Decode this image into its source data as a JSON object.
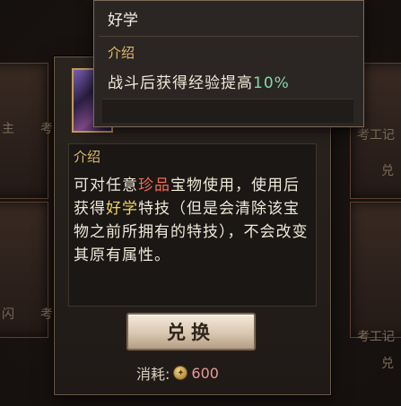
{
  "background": {
    "slot_labels": [
      "主",
      "考",
      "考工记",
      "兑",
      "闪",
      "考",
      "考工记",
      "兑"
    ]
  },
  "item": {
    "description_header": "介绍",
    "description": {
      "p1": "可对任意",
      "hl1": "珍品",
      "p2": "宝物使用，使用后获得",
      "hl2": "好学",
      "p3": "特技（但是会清除该宝物之前所拥有的特技），不会改变其原有属性。"
    }
  },
  "actions": {
    "redeem_label": "兑换",
    "cost_label": "消耗:",
    "cost_value": "600"
  },
  "tooltip": {
    "title": "好学",
    "header": "介绍",
    "text_prefix": "战斗后获得经验提高",
    "text_value": "10%"
  },
  "colors": {
    "accent_gold": "#e3bd6b",
    "highlight_red": "#ef6b56",
    "highlight_yellow": "#f2d45f",
    "percent_green": "#7fd9a6"
  }
}
